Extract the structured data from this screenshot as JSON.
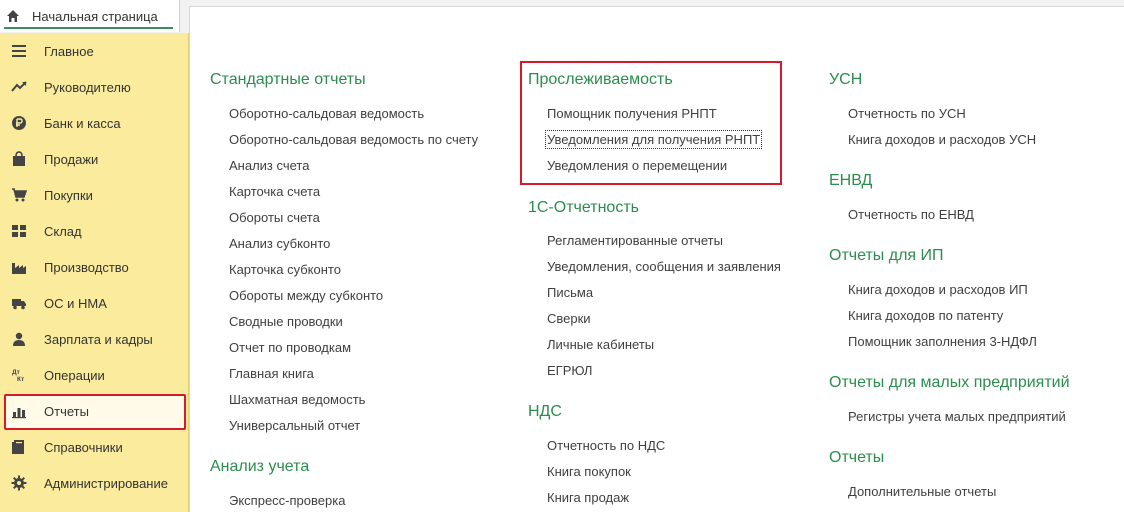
{
  "tabs": {
    "home_label": "Начальная страница"
  },
  "sidebar": {
    "items": [
      {
        "label": "Главное",
        "icon": "menu-icon"
      },
      {
        "label": "Руководителю",
        "icon": "trend-icon"
      },
      {
        "label": "Банк и касса",
        "icon": "ruble-icon"
      },
      {
        "label": "Продажи",
        "icon": "bag-icon"
      },
      {
        "label": "Покупки",
        "icon": "cart-icon"
      },
      {
        "label": "Склад",
        "icon": "grid-icon"
      },
      {
        "label": "Производство",
        "icon": "factory-icon"
      },
      {
        "label": "ОС и НМА",
        "icon": "truck-icon"
      },
      {
        "label": "Зарплата и кадры",
        "icon": "person-icon"
      },
      {
        "label": "Операции",
        "icon": "dt-kt-icon",
        "icon_text": "Дт\nКт"
      },
      {
        "label": "Отчеты",
        "icon": "bar-chart-icon",
        "active": true
      },
      {
        "label": "Справочники",
        "icon": "book-icon"
      },
      {
        "label": "Администрирование",
        "icon": "gear-icon"
      }
    ]
  },
  "colors": {
    "accent_green": "#2b8e4c",
    "sidebar_bg": "#fbec9d",
    "highlight_red": "#d7192e"
  },
  "content": {
    "col1": {
      "sec1_title": "Стандартные отчеты",
      "sec1_links": [
        "Оборотно-сальдовая ведомость",
        "Оборотно-сальдовая ведомость по счету",
        "Анализ счета",
        "Карточка счета",
        "Обороты счета",
        "Анализ субконто",
        "Карточка субконто",
        "Обороты между субконто",
        "Сводные проводки",
        "Отчет по проводкам",
        "Главная книга",
        "Шахматная ведомость",
        "Универсальный отчет"
      ],
      "sec2_title": "Анализ учета",
      "sec2_links": [
        "Экспресс-проверка"
      ]
    },
    "col2": {
      "sec1_title": "Прослеживаемость",
      "sec1_links": [
        "Помощник получения РНПТ",
        "Уведомления для получения РНПТ",
        "Уведомления о перемещении"
      ],
      "sec2_title": "1С-Отчетность",
      "sec2_links": [
        "Регламентированные отчеты",
        "Уведомления, сообщения и заявления",
        "Письма",
        "Сверки",
        "Личные кабинеты",
        "ЕГРЮЛ"
      ],
      "sec3_title": "НДС",
      "sec3_links": [
        "Отчетность по НДС",
        "Книга покупок",
        "Книга продаж"
      ]
    },
    "col3": {
      "sec1_title": "УСН",
      "sec1_links": [
        "Отчетность по УСН",
        "Книга доходов и расходов УСН"
      ],
      "sec2_title": "ЕНВД",
      "sec2_links": [
        "Отчетность по ЕНВД"
      ],
      "sec3_title": "Отчеты для ИП",
      "sec3_links": [
        "Книга доходов и расходов ИП",
        "Книга доходов по патенту",
        "Помощник заполнения 3-НДФЛ"
      ],
      "sec4_title": "Отчеты для малых предприятий",
      "sec4_links": [
        "Регистры учета малых предприятий"
      ],
      "sec5_title": "Отчеты",
      "sec5_links": [
        "Дополнительные отчеты"
      ]
    }
  }
}
